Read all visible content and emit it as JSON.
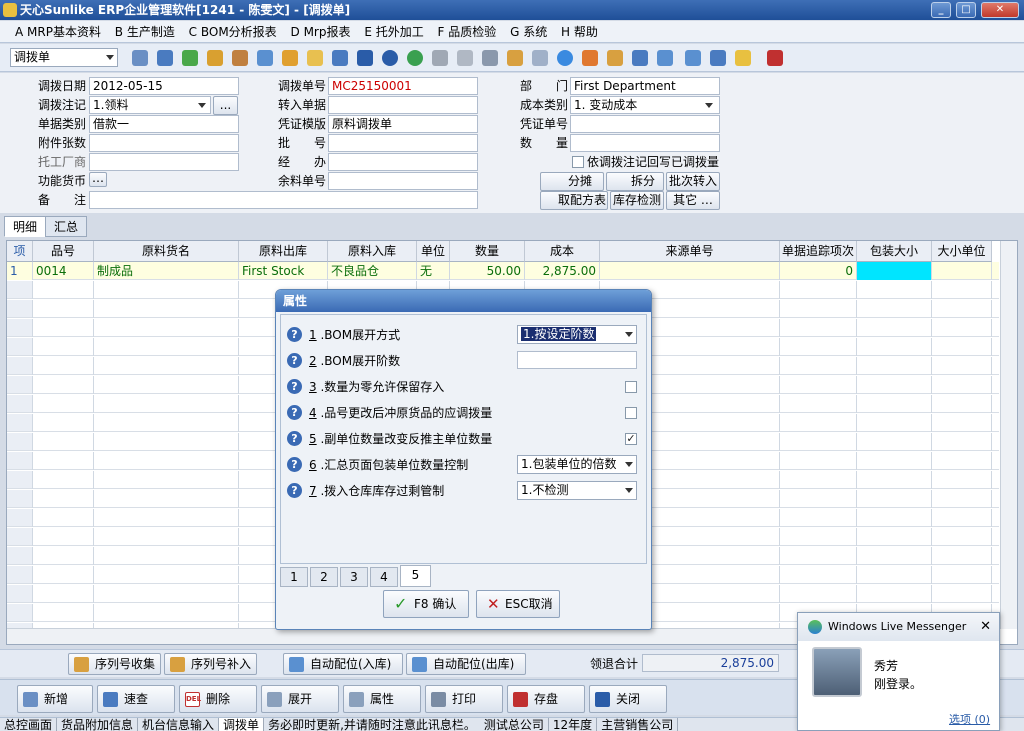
{
  "window": {
    "title": "天心Sunlike ERP企业管理软件[1241 - 陈雯文] - [调拨单]"
  },
  "menu": [
    "A MRP基本资料",
    "B 生产制造",
    "C BOM分析报表",
    "D Mrp报表",
    "E 托外加工",
    "F 品质检验",
    "G 系统",
    "H 帮助"
  ],
  "toolbar": {
    "doc_type": "调拨单"
  },
  "form": {
    "labels": {
      "date": "调拨日期",
      "posting": "调拨注记",
      "doc_category": "单据类别",
      "attachments": "附件张数",
      "processor": "托工厂商",
      "currency": "功能货币",
      "remark": "备　　注",
      "doc_no": "调拨单号",
      "transfer_in_doc": "转入单据",
      "voucher_template": "凭证模版",
      "batch": "批　　号",
      "handler": "经　　办",
      "leftover_doc": "余料单号",
      "department": "部　　门",
      "cost_type": "成本类别",
      "voucher_no": "凭证单号",
      "quantity": "数　　量"
    },
    "values": {
      "date": "2012-05-15",
      "posting": "1.领料",
      "doc_category": "借款一",
      "doc_no": "MC25150001",
      "voucher_template": "原料调拨单",
      "department": "First Department",
      "cost_type": "1. 变动成本"
    },
    "writeback_check": "依调拨注记回写已调拨量",
    "buttons": {
      "allocate": "分摊",
      "split": "拆分",
      "batch_in": "批次转入",
      "get_formula": "取配方表",
      "stock_check": "库存检测",
      "other": "其它 …",
      "browse": "...",
      "currency_browse": "…"
    }
  },
  "tabs": [
    "明细",
    "汇总"
  ],
  "grid": {
    "columns": [
      "项",
      "品号",
      "原料货名",
      "原料出库",
      "原料入库",
      "单位",
      "数量",
      "成本",
      "来源单号",
      "单据追踪项次",
      "包装大小",
      "大小单位"
    ],
    "rows": [
      [
        "1",
        "0014",
        "制成品",
        "First Stock",
        "不良品仓",
        "无",
        "50.00",
        "2,875.00",
        "",
        "0",
        "",
        ""
      ]
    ]
  },
  "dialog": {
    "title": "属性",
    "items": [
      {
        "num": "1",
        "label": " .BOM展开方式",
        "value": "1.按设定阶数"
      },
      {
        "num": "2",
        "label": " .BOM展开阶数",
        "value": ""
      },
      {
        "num": "3",
        "label": " .数量为零允许保留存入",
        "checked": false
      },
      {
        "num": "4",
        "label": " .品号更改后冲原货品的应调拨量",
        "checked": false
      },
      {
        "num": "5",
        "label": " .副单位数量改变反推主单位数量",
        "checked": true
      },
      {
        "num": "6",
        "label": " .汇总页面包装单位数量控制",
        "value": "1.包装单位的倍数"
      },
      {
        "num": "7",
        "label": " .拨入仓库库存过剩管制",
        "value": "1.不检测"
      }
    ],
    "pages": [
      "1",
      "2",
      "3",
      "4",
      "5"
    ],
    "active_page": "5",
    "ok": "F8 确认",
    "cancel": "ESC取消"
  },
  "bottom": {
    "serial_collect": "序列号收集",
    "serial_add": "序列号补入",
    "auto_in": "自动配位(入库)",
    "auto_out": "自动配位(出库)",
    "total_label": "领退合计",
    "total_value": "2,875.00"
  },
  "actions": [
    "新增",
    "速查",
    "删除",
    "展开",
    "属性",
    "打印",
    "存盘",
    "关闭"
  ],
  "del_tag": "DEL",
  "status": [
    "总控画面",
    "货品附加信息",
    "机台信息输入",
    "调拨单",
    "务必即时更新,并请随时注意此讯息栏。",
    "测试总公司",
    "12年度",
    "主营销售公司"
  ],
  "messenger": {
    "title": "Windows Live Messenger",
    "name": "秀芳",
    "message": "刚登录。",
    "options": "选项 (0)"
  },
  "colors": {
    "accent": "#3a6ab4",
    "grid_text": "#0a6e0a",
    "highlight_row": "#fefee0",
    "highlight_cell": "#00e5ff",
    "red": "#cc0000"
  }
}
